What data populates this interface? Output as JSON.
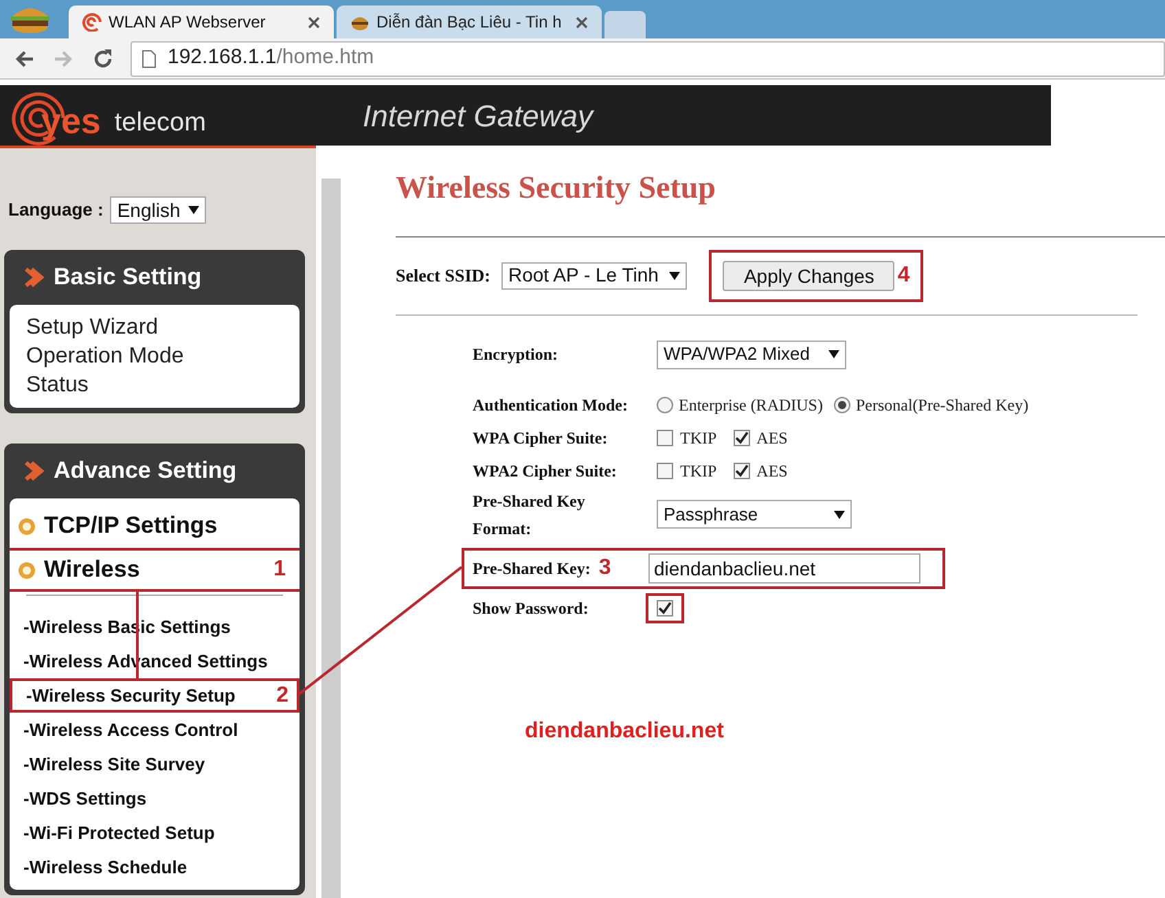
{
  "browser": {
    "tabs": [
      {
        "title": "WLAN AP Webserver",
        "selected": true
      },
      {
        "title": "Diễn đàn Bạc Liêu - Tin h",
        "selected": false
      }
    ],
    "address": {
      "host": "192.168.1.1",
      "path": "/home.htm"
    }
  },
  "header": {
    "brand": "yes",
    "brand_suffix": "telecom",
    "title": "Internet Gateway"
  },
  "sidebar": {
    "language_label": "Language :",
    "language": "English",
    "sections": [
      {
        "title": "Basic Setting",
        "items": [
          {
            "label": "Setup Wizard",
            "kind": "link"
          },
          {
            "label": "Operation Mode",
            "kind": "link"
          },
          {
            "label": "Status",
            "kind": "link"
          }
        ]
      },
      {
        "title": "Advance Setting",
        "items": [
          {
            "label": "TCP/IP Settings",
            "kind": "group"
          },
          {
            "label": "Wireless",
            "kind": "group",
            "marker": "1",
            "expanded": true,
            "children": [
              {
                "label": "-Wireless Basic Settings"
              },
              {
                "label": "-Wireless Advanced Settings"
              },
              {
                "label": "-Wireless Security Setup",
                "marker": "2"
              },
              {
                "label": "-Wireless Access Control"
              },
              {
                "label": "-Wireless Site Survey"
              },
              {
                "label": "-WDS Settings"
              },
              {
                "label": "-Wi-Fi Protected Setup"
              },
              {
                "label": "-Wireless Schedule"
              }
            ]
          }
        ]
      }
    ]
  },
  "content": {
    "title": "Wireless Security Setup",
    "ssid_label": "Select SSID:",
    "ssid": "Root AP - Le Tinh",
    "apply_button": {
      "label": "Apply Changes",
      "marker": "4"
    },
    "fields": [
      {
        "kind": "select",
        "label": "Encryption:",
        "value": "WPA/WPA2 Mixed"
      },
      {
        "kind": "radio",
        "label": "Authentication Mode:",
        "options": [
          {
            "label": "Enterprise (RADIUS)",
            "selected": false
          },
          {
            "label": "Personal(Pre-Shared Key)",
            "selected": true
          }
        ]
      },
      {
        "kind": "checkboxes",
        "label": "WPA Cipher Suite:",
        "options": [
          {
            "label": "TKIP",
            "checked": false
          },
          {
            "label": "AES",
            "checked": true
          }
        ]
      },
      {
        "kind": "checkboxes",
        "label": "WPA2 Cipher Suite:",
        "options": [
          {
            "label": "TKIP",
            "checked": false
          },
          {
            "label": "AES",
            "checked": true
          }
        ]
      },
      {
        "kind": "select",
        "label": "Pre-Shared Key Format:",
        "value": "Passphrase"
      },
      {
        "kind": "text",
        "label": "Pre-Shared Key:",
        "value": "diendanbaclieu.net",
        "marker": "3"
      },
      {
        "kind": "checkbox",
        "label": "Show Password:",
        "checked": true,
        "highlighted": true
      }
    ]
  },
  "site_note": "diendanbaclieu.net"
}
